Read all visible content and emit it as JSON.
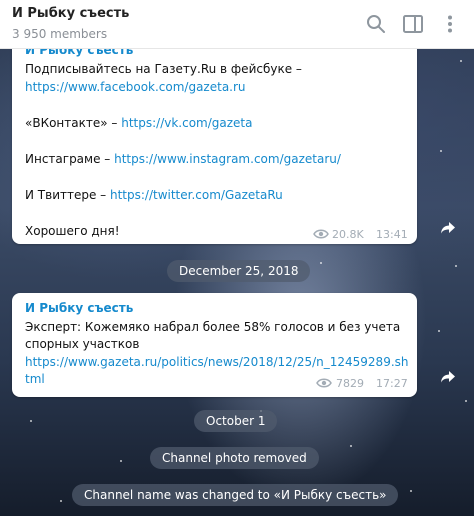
{
  "header": {
    "title": "И Рыбку съесть",
    "subtitle": "3 950 members",
    "icons": [
      "search-icon",
      "sidebar-toggle-icon",
      "more-icon"
    ]
  },
  "message1": {
    "author": "И Рыбку съесть",
    "lines": {
      "l1": "Подписывайтесь на Газету.Ru в фейсбуке –",
      "l1_link": "https://www.facebook.com/gazeta.ru",
      "l2_text": "«ВКонтакте» – ",
      "l2_link": "https://vk.com/gazeta",
      "l3_text": "Инстаграме – ",
      "l3_link": "https://www.instagram.com/gazetaru/",
      "l4_text": "И Твиттере – ",
      "l4_link": "https://twitter.com/GazetaRu",
      "l5": "Хорошего дня!"
    },
    "views": "20.8K",
    "time": "13:41"
  },
  "date_pill_1": "December 25, 2018",
  "message2": {
    "author": "И Рыбку съесть",
    "line1": "Эксперт: Кожемяко набрал более 58% голосов и без учета",
    "line2": "спорных участков",
    "link_line1": "https://www.gazeta.ru/politics/news/2018/12/25/n_12459289.sh",
    "link_line2": "tml",
    "views": "7829",
    "time": "17:27"
  },
  "date_pill_2": "October 1",
  "service_1": "Channel photo removed",
  "service_2": "Channel name was changed to «И Рыбку съесть»",
  "colors": {
    "accent": "#168acd",
    "header_bg": "#ffffff",
    "service_bg": "#505c6e"
  }
}
